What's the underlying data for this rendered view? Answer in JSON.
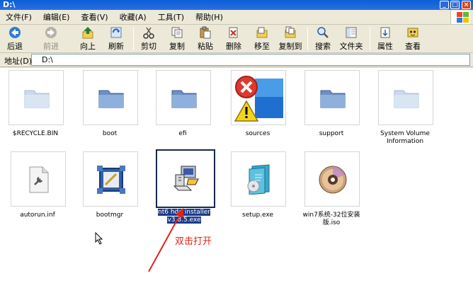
{
  "window": {
    "title": "D:\\"
  },
  "menu": [
    "文件(F)",
    "编辑(E)",
    "查看(V)",
    "收藏(A)",
    "工具(T)",
    "帮助(H)"
  ],
  "toolbar": {
    "back": "后退",
    "forward": "前进",
    "up": "向上",
    "refresh": "刷新",
    "cut": "剪切",
    "copy": "复制",
    "paste": "粘贴",
    "delete": "删除",
    "move_to": "移至",
    "copy_to": "复制到",
    "search": "搜索",
    "folders": "文件夹",
    "properties": "属性",
    "view": "查看"
  },
  "address": {
    "label": "地址(D)",
    "value": "D:\\"
  },
  "files": [
    {
      "name": "$RECYCLE.BIN",
      "icon": "folder-faded"
    },
    {
      "name": "boot",
      "icon": "folder"
    },
    {
      "name": "efi",
      "icon": "folder"
    },
    {
      "name": "sources",
      "icon": "warning-error"
    },
    {
      "name": "support",
      "icon": "folder"
    },
    {
      "name": "System Volume Information",
      "icon": "folder-faded"
    },
    {
      "name": "autorun.inf",
      "icon": "config-file"
    },
    {
      "name": "bootmgr",
      "icon": "system-file"
    },
    {
      "name": "nt6 hdd installer v3.8.5.exe",
      "icon": "installer",
      "selected": true
    },
    {
      "name": "setup.exe",
      "icon": "setup"
    },
    {
      "name": "win7系统-32位安装版.iso",
      "icon": "disc"
    }
  ],
  "annotation": {
    "text": "双击打开",
    "color": "#e0231a"
  }
}
